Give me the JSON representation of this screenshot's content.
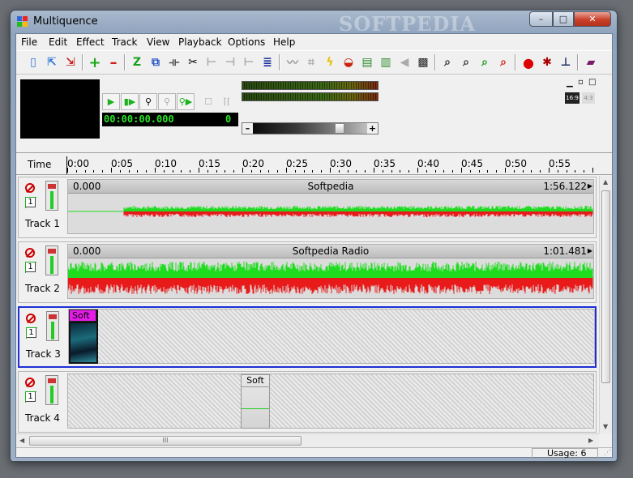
{
  "window": {
    "title": "Multiquence",
    "watermark": "SOFTPEDIA",
    "controls": {
      "minimize": "–",
      "maximize": "□",
      "close": "✕"
    }
  },
  "menu": [
    "File",
    "Edit",
    "Effect",
    "Track",
    "View",
    "Playback",
    "Options",
    "Help"
  ],
  "toolbar": {
    "icons": [
      "new-icon",
      "open-icon",
      "save-icon",
      "add-track-icon",
      "remove-track-icon",
      "zoom-z-icon",
      "copy-icon",
      "cut-icon",
      "split-left-icon",
      "split-icon",
      "split-right-icon",
      "list-icon",
      "wave-icon",
      "crop-icon",
      "lightning-icon",
      "fade-icon",
      "eq-icon",
      "mixer-icon",
      "speaker-icon",
      "clapper-icon",
      "zoom-1-icon",
      "zoom-2-icon",
      "zoom-in-icon",
      "zoom-out-icon",
      "record-icon",
      "effect-icon",
      "marker-icon",
      "book-icon"
    ]
  },
  "transport": {
    "timecode": "00:00:00.000",
    "counter": "0",
    "slider_value": 0.78,
    "slider_minus": "–",
    "slider_plus": "+",
    "aspect_16_9": "16:9",
    "aspect_4_3": "4:3"
  },
  "timeline": {
    "label": "Time",
    "ticks": [
      "0:00",
      "0:05",
      "0:10",
      "0:15",
      "0:20",
      "0:25",
      "0:30",
      "0:35",
      "0:40",
      "0:45",
      "0:50",
      "0:55"
    ]
  },
  "tracks": [
    {
      "name": "Track 1",
      "number": "1",
      "type": "audio",
      "clip": {
        "start": "0.000",
        "title": "Softpedia",
        "duration": "1:56.122"
      }
    },
    {
      "name": "Track 2",
      "number": "1",
      "type": "audio",
      "clip": {
        "start": "0.000",
        "title": "Softpedia Radio",
        "duration": "1:01.481"
      }
    },
    {
      "name": "Track 3",
      "number": "1",
      "type": "video",
      "clip": {
        "title": "Soft"
      }
    },
    {
      "name": "Track 4",
      "number": "1",
      "type": "image",
      "clip": {
        "title": "Soft"
      }
    }
  ],
  "colors": {
    "wave_green": "#1fdc1f",
    "wave_red": "#e81a1a",
    "selected_border": "#1c2fd4",
    "video_clip_label": "#e51ce8"
  },
  "status": {
    "usage": "Usage: 6"
  },
  "scrollbar": {
    "grip": "III"
  }
}
